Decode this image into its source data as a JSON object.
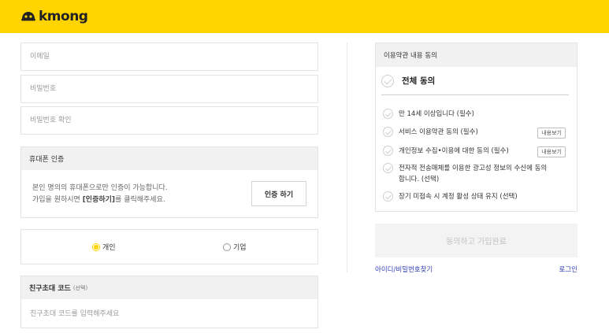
{
  "header": {
    "logo_text": "kmong",
    "brand_color": "#ffd400"
  },
  "form": {
    "email_placeholder": "이메일",
    "password_placeholder": "비밀번호",
    "password_confirm_placeholder": "비밀번호 확인"
  },
  "phone": {
    "title": "휴대폰 인증",
    "line1": "본인 명의의 휴대폰으로만 인증이 가능합니다.",
    "line2_prefix": "가입을 원하시면 ",
    "line2_strong": "[인증하기]",
    "line2_suffix": "를 클릭해주세요.",
    "button_label": "인증 하기"
  },
  "member_type": {
    "options": [
      {
        "label": "개인",
        "selected": true
      },
      {
        "label": "기업",
        "selected": false
      }
    ]
  },
  "invite": {
    "title": "친구초대 코드",
    "optional_label": "(선택)",
    "placeholder": "친구초대 코드를 입력해주세요"
  },
  "terms": {
    "title": "이용약관 내용 동의",
    "all_label": "전체 동의",
    "items": [
      {
        "label": "만 14세 이상입니다 (필수)"
      },
      {
        "label": "서비스 이용약관 동의 (필수)",
        "view_label": "내용보기"
      },
      {
        "label": "개인정보 수집•이용에 대한 동의 (필수)",
        "view_label": "내용보기"
      },
      {
        "label": "전자적 전송매체를 이용한 광고성 정보의 수신에 동의합니다. (선택)"
      },
      {
        "label": "장기 미접속 시 계정 활성 상태 유지 (선택)"
      }
    ]
  },
  "actions": {
    "submit_label": "동의하고 가입완료",
    "find_account_label": "아이디/비밀번호찾기",
    "login_label": "로그인"
  }
}
